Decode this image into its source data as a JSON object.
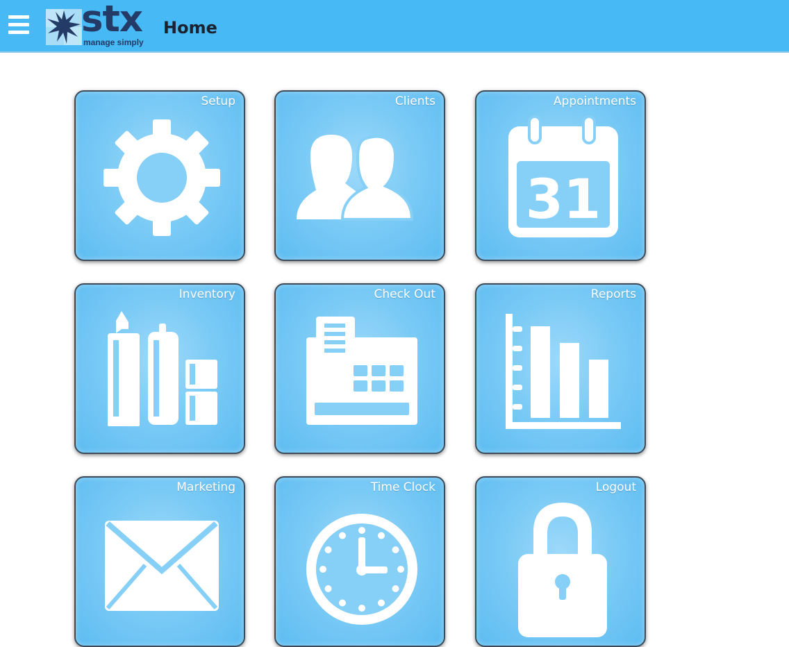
{
  "app": {
    "logo_text": "stx",
    "logo_tagline": "manage simply",
    "page_title": "Home"
  },
  "colors": {
    "header_bg": "#47b9f4",
    "tile_bg": "#7ccbf6",
    "logo_navy": "#233b66",
    "logo_light": "#a9dcf7"
  },
  "tiles": [
    {
      "label": "Setup",
      "icon": "gear-icon"
    },
    {
      "label": "Clients",
      "icon": "people-icon"
    },
    {
      "label": "Appointments",
      "icon": "calendar-icon",
      "icon_text": "31"
    },
    {
      "label": "Inventory",
      "icon": "products-icon"
    },
    {
      "label": "Check Out",
      "icon": "cash-register-icon"
    },
    {
      "label": "Reports",
      "icon": "bar-chart-icon"
    },
    {
      "label": "Marketing",
      "icon": "envelope-icon"
    },
    {
      "label": "Time Clock",
      "icon": "clock-icon"
    },
    {
      "label": "Logout",
      "icon": "lock-icon"
    }
  ]
}
